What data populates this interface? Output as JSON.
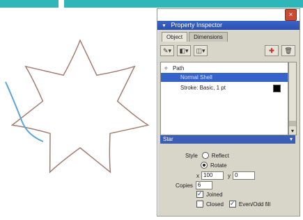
{
  "colors": {
    "accent_bar": "#2fb6b8",
    "shape_stroke": "#a47b6f",
    "shape_highlight": "#5aa5d6",
    "selection": "#3563c9"
  },
  "panel": {
    "title": "Property Inspector",
    "close_glyph": "×",
    "tabs": [
      {
        "label": "Object"
      },
      {
        "label": "Dimensions"
      }
    ],
    "toolbar": {
      "pen_icon": "pen-icon",
      "fill_icon": "fill-icon",
      "effect_icon": "effect-icon",
      "add_effect_label": "✚",
      "delete_icon": "trash-icon"
    },
    "list": {
      "path_label": "Path",
      "selected_label": "Normal Shell",
      "stroke_label": "Stroke: Basic, 1 pt"
    },
    "section_title": "Star",
    "props": {
      "style_label": "Style",
      "style_option1": "Reflect",
      "style_option2": "Rotate",
      "x_prefix": "x",
      "x_value": "100",
      "y_prefix": "y",
      "y_value": "0",
      "copies_label": "Copies",
      "copies_value": "6",
      "joined_label": "Joined",
      "closed_label": "Closed",
      "even_odd_label": "Even/Odd fill"
    }
  }
}
